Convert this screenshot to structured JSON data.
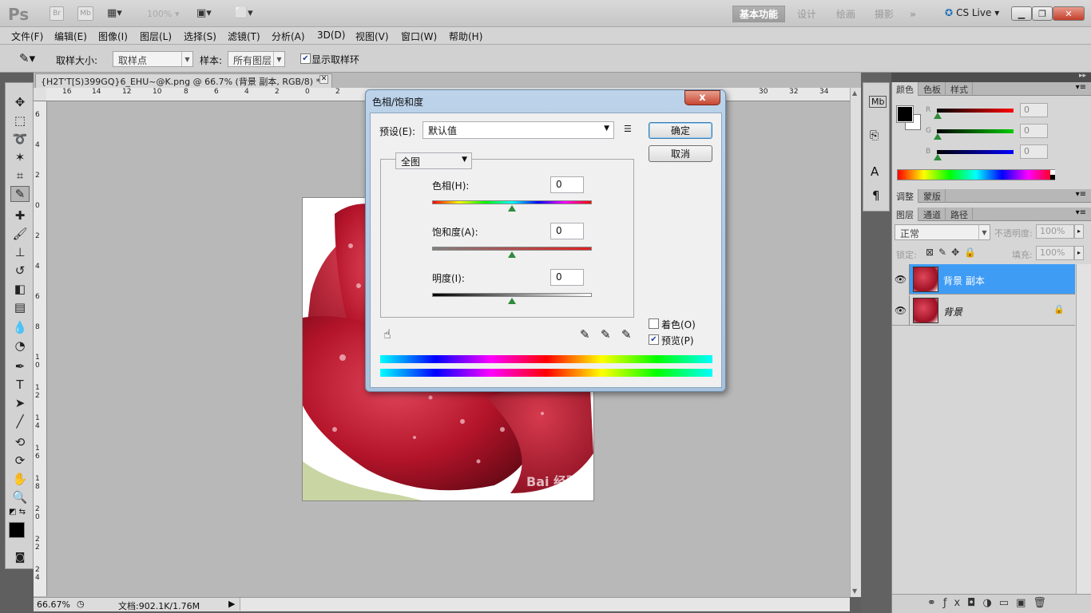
{
  "app": {
    "logo": "Ps",
    "bridge": "Br",
    "minibridge": "Mb",
    "zoom_display": "100%",
    "workspaces": [
      "基本功能",
      "设计",
      "绘画",
      "摄影"
    ],
    "overflow": "»",
    "cslive": "CS Live"
  },
  "menu": [
    "文件(F)",
    "编辑(E)",
    "图像(I)",
    "图层(L)",
    "选择(S)",
    "滤镜(T)",
    "分析(A)",
    "3D(D)",
    "视图(V)",
    "窗口(W)",
    "帮助(H)"
  ],
  "options": {
    "sample_size_label": "取样大小:",
    "sample_size_value": "取样点",
    "sample_label": "样本:",
    "sample_value": "所有图层",
    "show_ring_label": "显示取样环",
    "show_ring_checked": true
  },
  "document": {
    "tab_title": "{H2T'T[S)399GQ}6_EHU~@K.png @ 66.7% (背景 副本, RGB/8) *",
    "ruler_h": [
      "16",
      "14",
      "12",
      "10",
      "8",
      "6",
      "4",
      "2",
      "0",
      "2",
      "30",
      "32",
      "34"
    ],
    "ruler_v": [
      "6",
      "4",
      "2",
      "0",
      "2",
      "4",
      "6",
      "8",
      "1 0",
      "1 2",
      "1 4",
      "1 6",
      "1 8",
      "2 0",
      "2 2",
      "2 4"
    ],
    "watermark": "Bai 经验"
  },
  "status": {
    "zoom": "66.67%",
    "doc_info": "文档:902.1K/1.76M"
  },
  "dialog": {
    "title": "色相/饱和度",
    "close": "x",
    "preset_label": "预设(E):",
    "preset_value": "默认值",
    "ok": "确定",
    "cancel": "取消",
    "channel": "全图",
    "hue_label": "色相(H):",
    "hue_value": "0",
    "saturation_label": "饱和度(A):",
    "saturation_value": "0",
    "lightness_label": "明度(I):",
    "lightness_value": "0",
    "colorize_label": "着色(O)",
    "colorize_checked": false,
    "preview_label": "预览(P)",
    "preview_checked": true
  },
  "color_panel": {
    "tabs": [
      "颜色",
      "色板",
      "样式"
    ],
    "r_label": "R",
    "r_value": "0",
    "g_label": "G",
    "g_value": "0",
    "b_label": "B",
    "b_value": "0"
  },
  "adjust_panel": {
    "tabs": [
      "调整",
      "蒙版"
    ]
  },
  "layers_panel": {
    "tabs": [
      "图层",
      "通道",
      "路径"
    ],
    "blend_mode": "正常",
    "opacity_label": "不透明度:",
    "opacity_value": "100%",
    "lock_label": "锁定:",
    "fill_label": "填充:",
    "fill_value": "100%",
    "layers": [
      {
        "name": "背景 副本",
        "selected": true
      },
      {
        "name": "背景",
        "selected": false
      }
    ]
  },
  "colors": {
    "accent_selected_layer": "#3f9cf5",
    "toolbar_bg": "#d2d2d2",
    "canvas_bg": "#b8b8b8"
  }
}
